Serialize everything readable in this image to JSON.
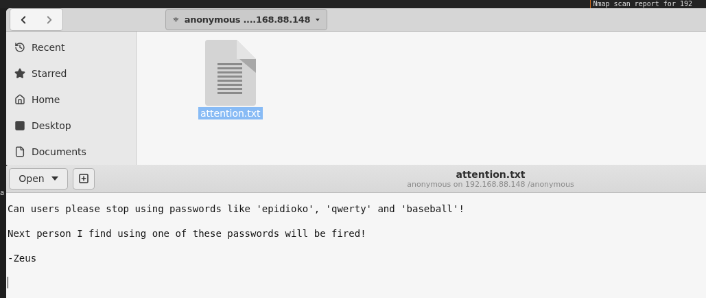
{
  "terminal": {
    "top_line": "Nmap scan report for 192",
    "side_char": "a"
  },
  "file_manager": {
    "location": "anonymous ....168.88.148",
    "sidebar": {
      "items": [
        {
          "kind": "recent",
          "label": "Recent",
          "selected": false
        },
        {
          "kind": "starred",
          "label": "Starred",
          "selected": false
        },
        {
          "kind": "home",
          "label": "Home",
          "selected": false
        },
        {
          "kind": "desktop",
          "label": "Desktop",
          "selected": false
        },
        {
          "kind": "documents",
          "label": "Documents",
          "selected": false
        }
      ]
    },
    "files": [
      {
        "name": "attention.txt",
        "selected": true
      }
    ]
  },
  "editor": {
    "open_label": "Open",
    "title": "attention.txt",
    "subtitle": "anonymous on 192.168.88.148 /anonymous",
    "lines": [
      "Can users please stop using passwords like 'epidioko', 'qwerty' and 'baseball'!",
      "Next person I find using one of these passwords will be fired!",
      "-Zeus"
    ]
  }
}
